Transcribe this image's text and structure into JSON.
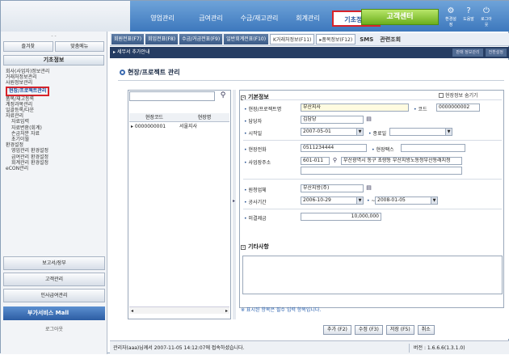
{
  "topmenu": [
    "영업관리",
    "급여관리",
    "수금/재고관리",
    "회계관리",
    "기초정보"
  ],
  "cs_button": "고객센터",
  "topicons": [
    {
      "icon": "printer-icon",
      "label": "환경설정"
    },
    {
      "icon": "help-icon",
      "label": "도움말"
    },
    {
      "icon": "exit-icon",
      "label": "로그아웃"
    }
  ],
  "toolbar": [
    "회원전표(F7)",
    "회입전표(F8)",
    "수금/거금전표(F9)",
    "일반회계전표(F10)",
    "K거래처정보(F11)",
    "▸품목정보(F12)"
  ],
  "toolbar_sms": "SMS",
  "toolbar_more": "관련조회",
  "breadcrumb": "▸ 세무서 추가안내",
  "crumb_right": [
    "판매 정보관리",
    "전환설정"
  ],
  "sidebar": {
    "top": "- -",
    "tab1": "즐겨찾",
    "tab2": "맞춤메뉴",
    "header": "기초정보",
    "items": [
      "회사(사업자)정보관리",
      "거래처정보관리",
      "사원정보관리"
    ],
    "selected": "현장/프로젝트관리",
    "items2": [
      "품목/재고등록",
      "계정과목관리",
      "일괄등록/다운",
      "자료관리"
    ],
    "items_ind": [
      "자료입력",
      "자료변환(회계)",
      "손금처분 자료",
      "초기이월"
    ],
    "items3": [
      "환경설정"
    ],
    "items_ind2": [
      "영업관리 환경설정",
      "급여관리 환경설정",
      "회계관리 환경설정"
    ],
    "items4": [
      "eCON관리"
    ],
    "bottom": [
      "보고서/장부",
      "고객관리",
      "인사급여관리"
    ],
    "mall": "부가서비스 Mall",
    "logout": "로그아웃"
  },
  "page_title": "현장/프로젝트 관리",
  "grid": {
    "head": [
      "현장코드",
      "현장명"
    ],
    "row": {
      "code": "0000000001",
      "name": "서울지사"
    }
  },
  "form": {
    "section1": "기본정보",
    "hide_info": "현장정보 숨기기",
    "site_name_label": "현장/프로젝트명",
    "site_name": "부산지사",
    "code_label": "코드",
    "code": "0000000002",
    "manager_label": "담당자",
    "manager": "김담당",
    "start_label": "시작일",
    "start": "2007-05-01",
    "end_label": "종료일",
    "phone_label": "현장전화",
    "phone": "0511234444",
    "fax_label": "현장팩스",
    "addr_label": "사업장주소",
    "zip": "601-011",
    "addr": "부산광역시 동구 초량동 부산지방노동청부산동래지청",
    "contractor_label": "원청업체",
    "contractor": "부산지방(주)",
    "period_label": "공사기간",
    "period_from": "2006-10-29",
    "period_to": "2008-01-05",
    "unpaid_label": "미결제금",
    "unpaid": "10,000,000",
    "section2": "기타사항",
    "note": "※ 표시된 항목은 필수 입력 항목입니다."
  },
  "buttons": [
    "추가 (F2)",
    "수정 (F3)",
    "저장 (F5)",
    "취소"
  ],
  "status": {
    "left": "관리자(aaa)님께서 2007-11-05 14:12:07에 접속하셨습니다.",
    "version": "버전 : 1.6.6.6(1.3.1.0)"
  }
}
